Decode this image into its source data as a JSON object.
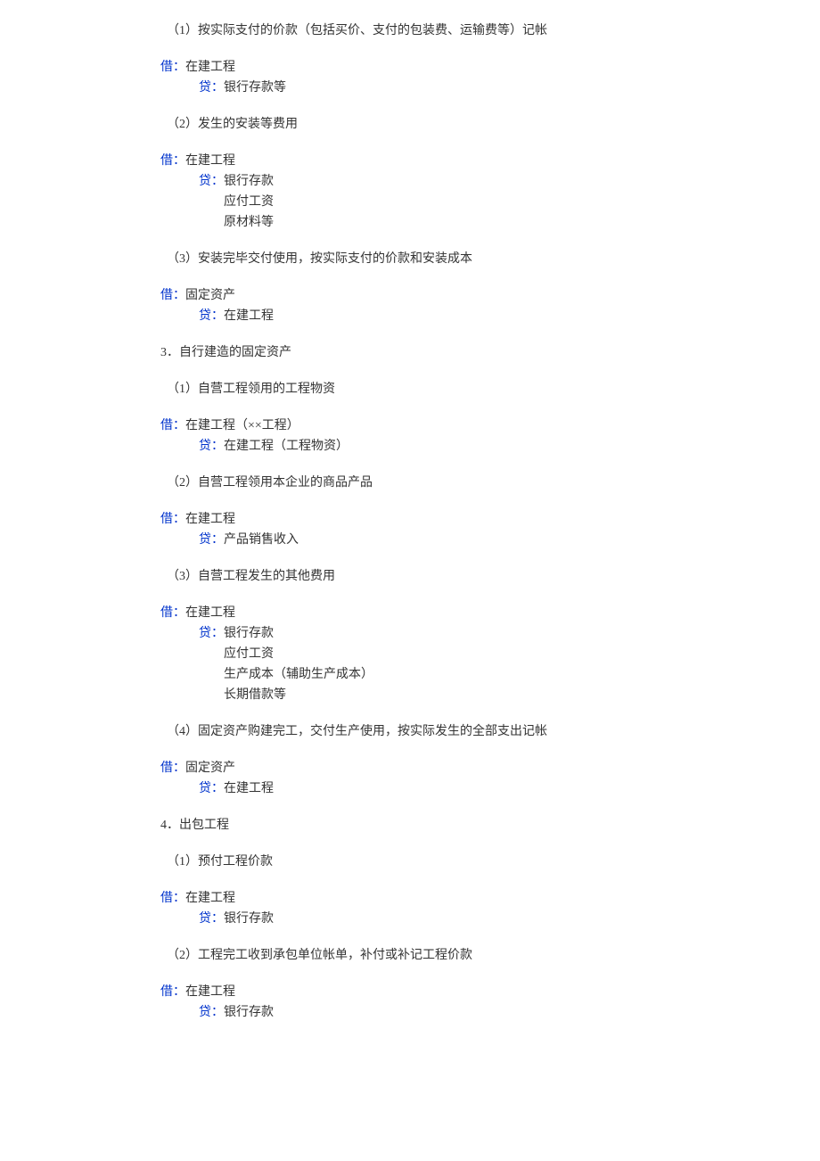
{
  "lines": {
    "l01": "（1）按实际支付的价款（包括买价、支付的包装费、运输费等）记帐",
    "l02_label": "借：",
    "l02_text": "在建工程",
    "l03_label": "贷：",
    "l03_text": "银行存款等",
    "l04": "（2）发生的安装等费用",
    "l05_label": "借：",
    "l05_text": "在建工程",
    "l06_label": "贷：",
    "l06_text": "银行存款",
    "l07": "应付工资",
    "l08": "原材料等",
    "l09": "（3）安装完毕交付使用，按实际支付的价款和安装成本",
    "l10_label": "借：",
    "l10_text": "固定资产",
    "l11_label": "贷：",
    "l11_text": "在建工程",
    "l12": "3．自行建造的固定资产",
    "l13": "（1）自营工程领用的工程物资",
    "l14_label": "借：",
    "l14_text": "在建工程（××工程）",
    "l15_label": "贷：",
    "l15_text": "在建工程（工程物资）",
    "l16": "（2）自营工程领用本企业的商品产品",
    "l17_label": "借：",
    "l17_text": "在建工程",
    "l18_label": "贷：",
    "l18_text": "产品销售收入",
    "l19": "（3）自营工程发生的其他费用",
    "l20_label": "借：",
    "l20_text": "在建工程",
    "l21_label": "贷：",
    "l21_text": "银行存款",
    "l22": "应付工资",
    "l23": "生产成本（辅助生产成本）",
    "l24": "长期借款等",
    "l25": "（4）固定资产购建完工，交付生产使用，按实际发生的全部支出记帐",
    "l26_label": "借：",
    "l26_text": "固定资产",
    "l27_label": "贷：",
    "l27_text": "在建工程",
    "l28": "4．出包工程",
    "l29": "（1）预付工程价款",
    "l30_label": "借：",
    "l30_text": "在建工程",
    "l31_label": "贷：",
    "l31_text": "银行存款",
    "l32": "（2）工程完工收到承包单位帐单，补付或补记工程价款",
    "l33_label": "借：",
    "l33_text": "在建工程",
    "l34_label": "贷：",
    "l34_text": "银行存款"
  }
}
